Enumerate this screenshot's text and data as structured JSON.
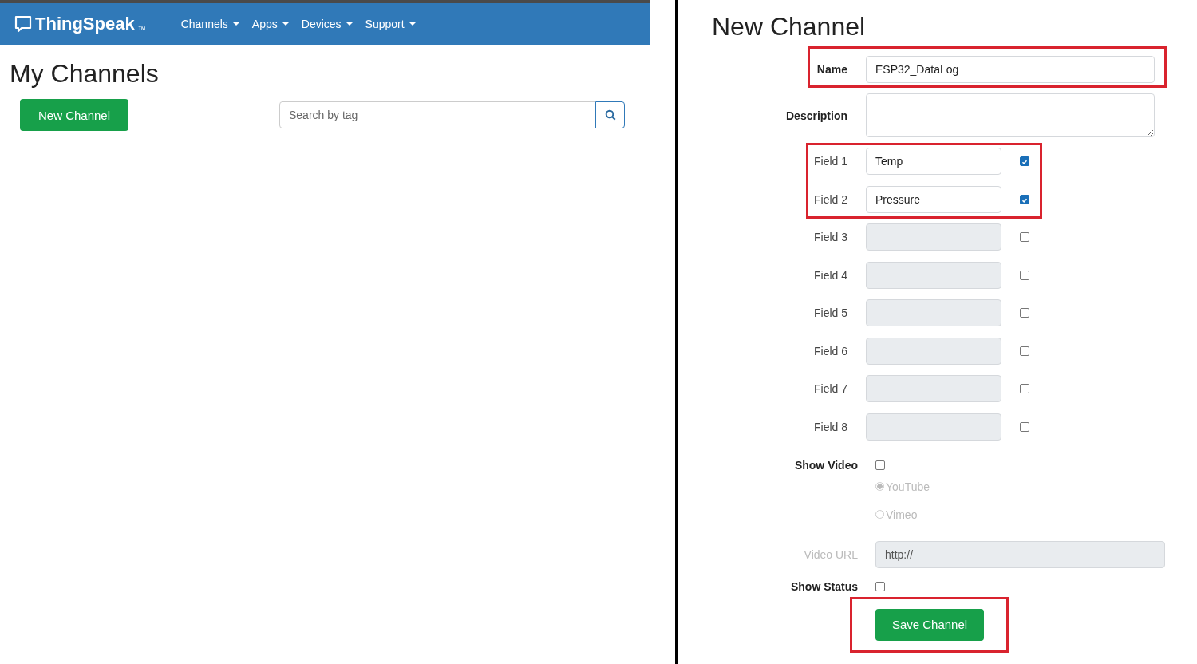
{
  "my_channels_page": {
    "navbar": {
      "logo": "ThingSpeak",
      "logo_mark": "™",
      "menu": [
        {
          "label": "Channels"
        },
        {
          "label": "Apps"
        },
        {
          "label": "Devices"
        },
        {
          "label": "Support"
        }
      ]
    },
    "title": "My Channels",
    "new_channel_button": "New Channel",
    "search": {
      "placeholder": "Search by tag"
    }
  },
  "new_channel_page": {
    "title": "New Channel",
    "name": {
      "label": "Name",
      "value": "ESP32_DataLog",
      "highlighted": true
    },
    "description": {
      "label": "Description"
    },
    "fields": [
      {
        "label": "Field 1",
        "value": "Temp",
        "checked": true,
        "highlighted": true
      },
      {
        "label": "Field 2",
        "value": "Pressure",
        "checked": true,
        "highlighted": true
      },
      {
        "label": "Field 3",
        "checked": false,
        "highlighted": false
      },
      {
        "label": "Field 4",
        "checked": false,
        "highlighted": false
      },
      {
        "label": "Field 5",
        "checked": false,
        "highlighted": false
      },
      {
        "label": "Field 6",
        "checked": false,
        "highlighted": false
      },
      {
        "label": "Field 7",
        "checked": false,
        "highlighted": false
      },
      {
        "label": "Field 8",
        "checked": false,
        "highlighted": false
      }
    ],
    "show_video": {
      "label": "Show Video",
      "checked": false
    },
    "video_options": [
      {
        "label": "YouTube",
        "selected": true,
        "disabled": true
      },
      {
        "label": "Vimeo",
        "selected": false,
        "disabled": true
      }
    ],
    "video_url": {
      "label": "Video URL",
      "value": "http://",
      "disabled": true
    },
    "show_status": {
      "label": "Show Status",
      "checked": false
    },
    "save_button": {
      "label": "Save Channel",
      "highlighted": true
    }
  }
}
